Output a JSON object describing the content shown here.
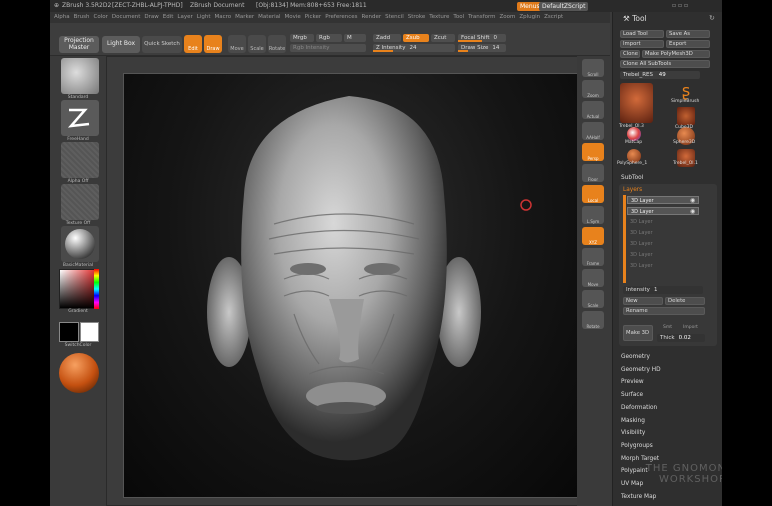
{
  "titlebar": {
    "app": "ZBrush 3.5R2D2",
    "id": "[ZECT-ZHBL-ALPJ-TPHD]",
    "doc": "ZBrush Document",
    "stats": "[Obj:8134] Mem:808+653 Free:1811",
    "menus_btn": "Menus",
    "script_btn": "DefaultZScript"
  },
  "menubar": [
    "Alpha",
    "Brush",
    "Color",
    "Document",
    "Draw",
    "Edit",
    "Layer",
    "Light",
    "Macro",
    "Marker",
    "Material",
    "Movie",
    "Picker",
    "Preferences",
    "Render",
    "Stencil",
    "Stroke",
    "Texture",
    "Tool",
    "Transform",
    "Zoom",
    "Zplugin",
    "Zscript"
  ],
  "shelf": {
    "projection_master": "Projection Master",
    "lightbox": "Light Box",
    "quick_sketch": "Quick Sketch",
    "edit": "Edit",
    "draw": "Draw",
    "move": "Move",
    "scale": "Scale",
    "rotate": "Rotate",
    "mrgb": "Mrgb",
    "rgb": "Rgb",
    "m": "M",
    "zadd": "Zadd",
    "zsub": "Zsub",
    "zcut": "Zcut",
    "rgb_intensity": "Rgb Intensity",
    "z_intensity_label": "Z Intensity",
    "z_intensity_val": "24",
    "focal_shift_label": "Focal Shift",
    "focal_shift_val": "0",
    "draw_size_label": "Draw Size",
    "draw_size_val": "14"
  },
  "leftshelf": {
    "brush": "Standard",
    "stroke": "FreeHand",
    "alpha": "Alpha Off",
    "texture": "Texture Off",
    "material": "BasicMaterial",
    "gradient": "Gradient",
    "switchcolor": "SwitchColor"
  },
  "rightshelf": [
    "Scroll",
    "Zoom",
    "Actual",
    "AAHalf",
    "Persp",
    "Floor",
    "Local",
    "L.Sym",
    "XYZ",
    "Frame",
    "Move",
    "Scale",
    "Rotate"
  ],
  "toolpanel": {
    "title": "Tool",
    "load": "Load Tool",
    "save": "Save As",
    "import": "Import",
    "export": "Export",
    "clone": "Clone",
    "polymesh": "Make PolyMesh3D",
    "clone_all": "Clone All SubTools",
    "rebel": "Trebel_RES",
    "rebel_val": "49",
    "thumbs": [
      "Trebel_Ol.3",
      "SimpleBrush",
      "Cube3D",
      "MatCap",
      "Sphere3D",
      "PolySphere_1",
      "Trebel_Ol.1"
    ],
    "subtool": "SubTool",
    "layers": "Layers",
    "layer_items": [
      "3D Layer",
      "3D Layer",
      "3D Layer",
      "3D Layer",
      "3D Layer",
      "3D Layer",
      "3D Layer"
    ],
    "intensity_label": "Intensity",
    "intensity_val": "1",
    "new": "New",
    "delete": "Delete",
    "rename": "Rename",
    "make3d": "Make 3D",
    "smt": "Smt",
    "import_btn": "Import",
    "thick_label": "Thick",
    "thick_val": "0.02",
    "sections": [
      "Geometry",
      "Geometry HD",
      "Preview",
      "Surface",
      "Deformation",
      "Masking",
      "Visibility",
      "Polygroups",
      "Morph Target",
      "Polypaint",
      "UV Map",
      "Texture Map"
    ]
  },
  "watermark": "THE GNOMON WORKSHOP",
  "colors": {
    "accent": "#e8821c",
    "panel": "#2f2f2f",
    "bg": "#3a3a3a"
  }
}
